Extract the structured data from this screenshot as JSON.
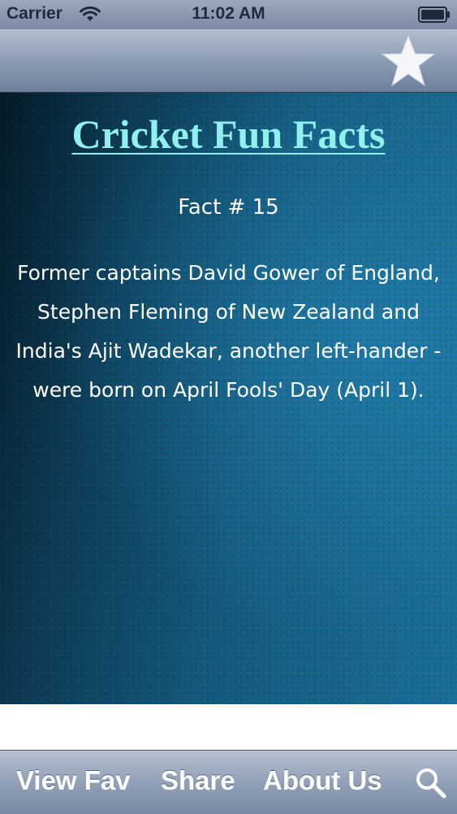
{
  "status_bar": {
    "carrier": "Carrier",
    "time": "11:02 AM",
    "wifi_icon": "wifi-icon",
    "battery_icon": "battery-icon"
  },
  "nav_bar": {
    "favorite_icon": "star-icon"
  },
  "content": {
    "title": "Cricket Fun Facts",
    "fact_number": "Fact # 15",
    "fact_text": "Former captains David Gower of England, Stephen Fleming of New Zealand and India's Ajit Wadekar, another left-hander - were born on April Fools' Day (April 1).",
    "title_color": "#8ff0ee"
  },
  "tab_bar": {
    "view_fav_label": "View Fav",
    "share_label": "Share",
    "about_us_label": "About Us",
    "search_icon": "search-icon"
  }
}
